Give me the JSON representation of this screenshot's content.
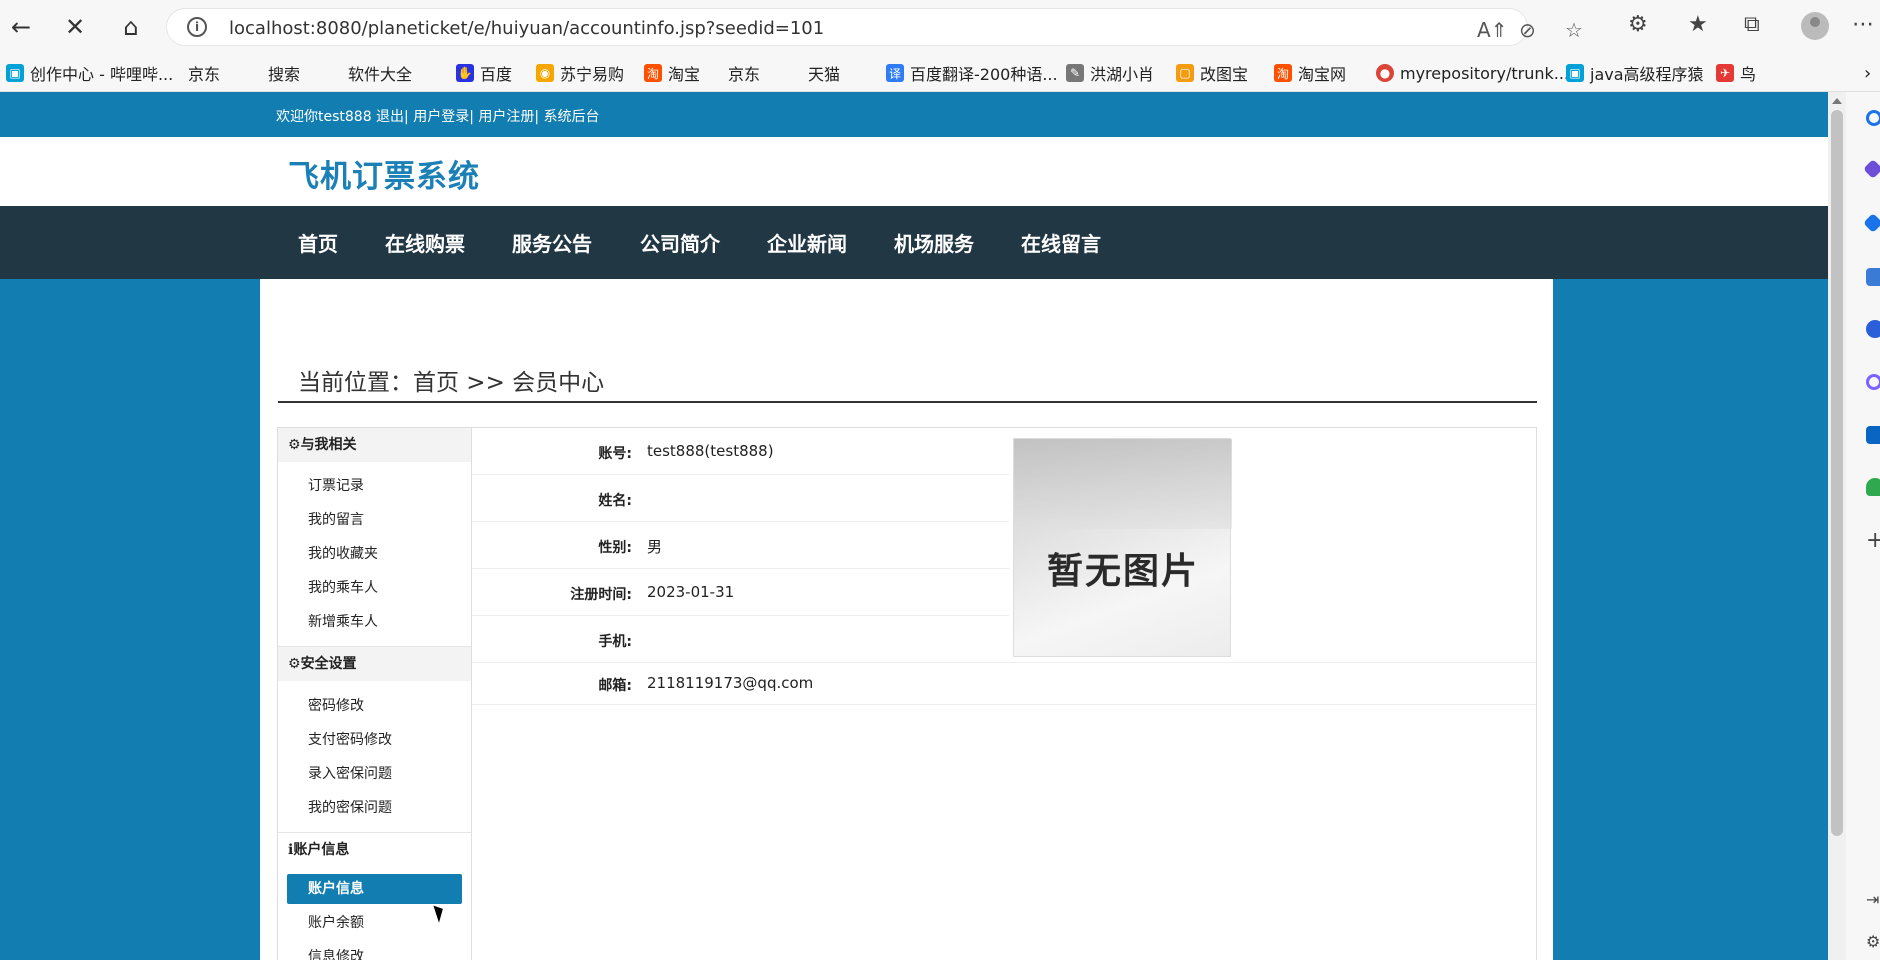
{
  "browser": {
    "url": "localhost:8080/planeticket/e/huiyuan/accountinfo.jsp?seedid=101",
    "bookmarks": [
      {
        "label": "创作中心 - 哔哩哔...",
        "icon": "bilibili-icon",
        "color": "#00a1d6"
      },
      {
        "label": "京东",
        "icon": "page-icon"
      },
      {
        "label": "搜索",
        "icon": "page-icon"
      },
      {
        "label": "软件大全",
        "icon": "page-icon"
      },
      {
        "label": "百度",
        "icon": "baidu-icon",
        "color": "#2932e1"
      },
      {
        "label": "苏宁易购",
        "icon": "suning-icon",
        "color": "#f7a600"
      },
      {
        "label": "淘宝",
        "icon": "taobao-icon",
        "color": "#ff5000"
      },
      {
        "label": "京东",
        "icon": "page-icon"
      },
      {
        "label": "天猫",
        "icon": "page-icon"
      },
      {
        "label": "百度翻译-200种语...",
        "icon": "translate-icon",
        "color": "#2f7cf6"
      },
      {
        "label": "洪湖小肖",
        "icon": "feather-icon",
        "color": "#777777"
      },
      {
        "label": "改图宝",
        "icon": "gaitubao-icon",
        "color": "#f39c12"
      },
      {
        "label": "淘宝网",
        "icon": "taobao-icon",
        "color": "#ff5000"
      },
      {
        "label": "myrepository/trunk...",
        "icon": "chrome-icon",
        "color": "#db4437"
      },
      {
        "label": "java高级程序猿",
        "icon": "bilibili-icon",
        "color": "#00a1d6"
      },
      {
        "label": "鸟",
        "icon": "bird-icon",
        "color": "#e53935"
      }
    ]
  },
  "site": {
    "topbar_links": "欢迎你test888 退出| 用户登录| 用户注册| 系统后台",
    "logo": "飞机订票系统",
    "nav": [
      "首页",
      "在线购票",
      "服务公告",
      "公司简介",
      "企业新闻",
      "机场服务",
      "在线留言"
    ],
    "breadcrumb": "当前位置：首页 >> 会员中心"
  },
  "sidebar": {
    "groups": [
      {
        "title": "与我相关",
        "items": [
          "订票记录",
          "我的留言",
          "我的收藏夹",
          "我的乘车人",
          "新增乘车人"
        ]
      },
      {
        "title": "安全设置",
        "items": [
          "密码修改",
          "支付密码修改",
          "录入密保问题",
          "我的密保问题"
        ]
      },
      {
        "title": "账户信息",
        "items": [
          "账户信息",
          "账户余额",
          "信息修改"
        ],
        "active": "账户信息"
      }
    ]
  },
  "account": {
    "rows": [
      {
        "label": "账号:",
        "value": "test888(test888)"
      },
      {
        "label": "姓名:",
        "value": ""
      },
      {
        "label": "性别:",
        "value": "男"
      },
      {
        "label": "注册时间:",
        "value": "2023-01-31"
      },
      {
        "label": "手机:",
        "value": ""
      },
      {
        "label": "邮箱:",
        "value": "2118119173@qq.com"
      }
    ],
    "photo_placeholder": "暂无图片"
  },
  "colors": {
    "brand_blue": "#127db0",
    "nav_dark": "#223744",
    "logo_blue": "#1a80b6"
  }
}
